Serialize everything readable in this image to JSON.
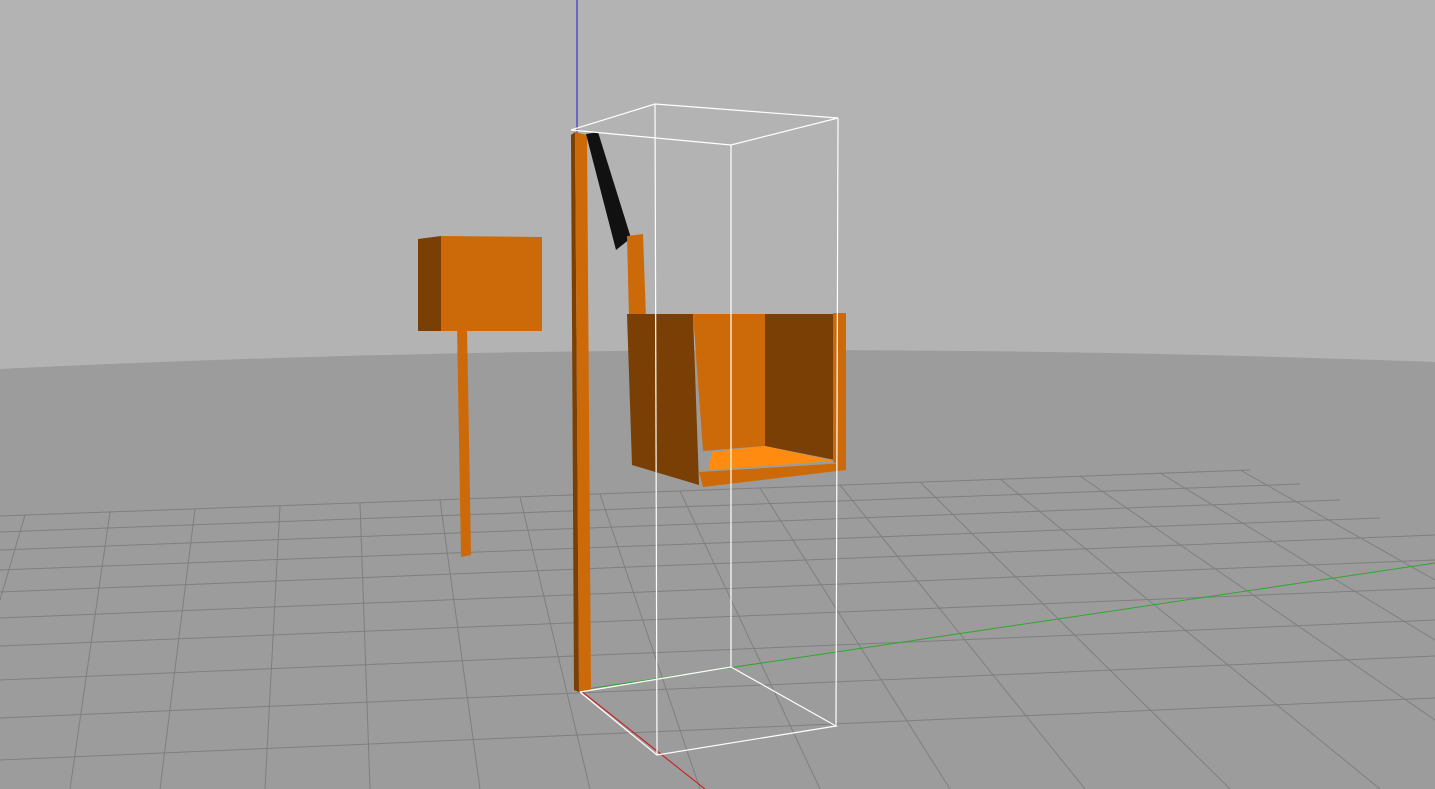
{
  "viewport": {
    "sky_color": "#b3b3b3",
    "ground_color": "#9c9c9c",
    "grid_line_color": "#7f7f7f",
    "bounding_box_color": "#ffffff",
    "axis_colors": {
      "x": "#d21414",
      "y": "#2ea82e",
      "z": "#1f1fd6"
    }
  },
  "objects": [
    {
      "name": "post-with-sign",
      "color": "#cc6a0a",
      "shade_color": "#7a3f04",
      "selected": false
    },
    {
      "name": "tall-post",
      "color": "#cc6a0a",
      "shade_color": "#7a3f04",
      "selected": true
    },
    {
      "name": "hanging-bin",
      "color": "#cc6a0a",
      "shade_color": "#7a3f04",
      "floor_color": "#ff8c10",
      "selected": true
    },
    {
      "name": "link-arm",
      "color": "#111111",
      "selected": true
    }
  ]
}
